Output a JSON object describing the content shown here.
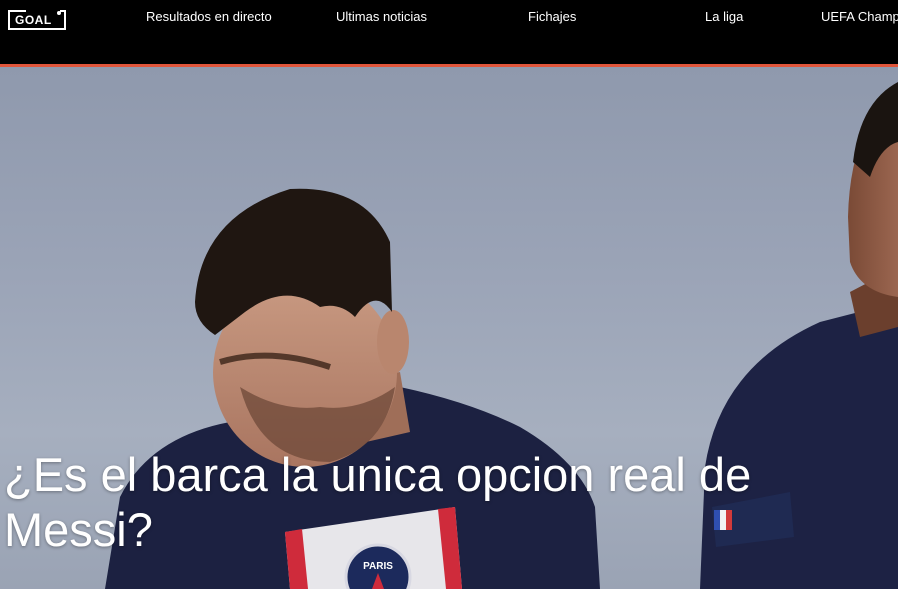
{
  "header": {
    "logo_text": "GOAL",
    "nav": [
      {
        "label": "Resultados en directo"
      },
      {
        "label": "Ultimas noticias"
      },
      {
        "label": "Fichajes"
      },
      {
        "label": "La liga"
      },
      {
        "label": "UEFA Champ"
      }
    ],
    "accent_color": "#e0553a"
  },
  "hero": {
    "headline": "¿Es el barca la unica opcion real de Messi?",
    "badge_text": "PARIS"
  }
}
